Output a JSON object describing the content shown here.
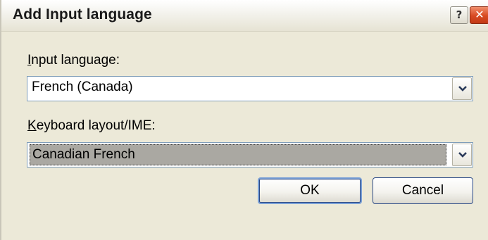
{
  "dialog": {
    "title": "Add Input language",
    "help_glyph": "?",
    "close_glyph": "✕"
  },
  "input_language": {
    "label_prefix": "I",
    "label_rest": "nput language:",
    "value": "French (Canada)"
  },
  "keyboard_layout": {
    "label_prefix": "K",
    "label_rest": "eyboard layout/IME:",
    "value": "Canadian French"
  },
  "buttons": {
    "ok_label": "OK",
    "cancel_label": "Cancel"
  },
  "icons": {
    "help": "help-icon",
    "close": "close-icon",
    "dropdown": "chevron-down-icon"
  },
  "colors": {
    "selection_bg": "#aaa8a2",
    "combo_border": "#7f9db9",
    "dialog_bg": "#ece9d8"
  }
}
